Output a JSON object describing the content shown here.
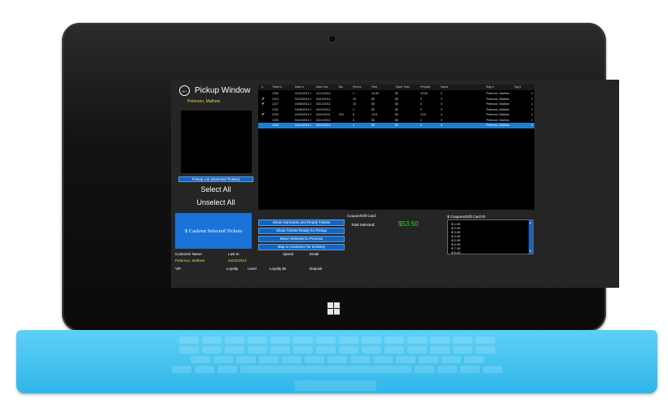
{
  "window": {
    "title": "Pickup Window",
    "back_glyph": "←",
    "customer_name": "Peterson, Mathew"
  },
  "left": {
    "pickup_list_label": "Pickup List (Selected Tickets)",
    "select_all": "Select All",
    "unselect_all": "Unselect All",
    "cashout_label": "$ Cashout Selected Tickets"
  },
  "customer_info": {
    "name_label": "Customer Name",
    "name_value": "Peterson, Mathew",
    "last_in_label": "Last In",
    "last_in_value": "04/10/2014",
    "vip_label": "VIP",
    "loyalty_label": "Loyalty",
    "level_label": "Level",
    "loyalty_dollars_label": "Loyalty $s",
    "spend_label": "Spend",
    "email_label": "Email",
    "deposit_label": "Deposit"
  },
  "tickets": {
    "columns": [
      "#",
      "Ticket #",
      "Date In",
      "Date Due",
      "Bin",
      "Pieces",
      "Paid",
      "Ticket Total",
      "Prepaid",
      "Name",
      "Bag #",
      "Tag #"
    ],
    "check_glyph": "✔",
    "rows": [
      {
        "checked": false,
        "selected": false,
        "cells": [
          "",
          "1200",
          "01/11/2014 1",
          "01/12/2014",
          "",
          "1",
          "19.50",
          "$0",
          "19.50",
          "0",
          "Peterson, Mathew",
          "",
          "1"
        ]
      },
      {
        "checked": true,
        "selected": false,
        "cells": [
          "",
          "1213",
          "03/15/2014 1",
          "03/19/2014",
          "",
          "15",
          "$0",
          "$0",
          "0",
          "0",
          "Peterson, Mathew",
          "",
          "1"
        ]
      },
      {
        "checked": true,
        "selected": false,
        "cells": [
          "",
          "1227",
          "04/08/2014 1",
          "04/12/2014",
          "",
          "15",
          "$0",
          "$0",
          "0",
          "0",
          "Peterson, Mathew",
          "",
          "1"
        ]
      },
      {
        "checked": false,
        "selected": false,
        "cells": [
          "",
          "1231",
          "04/08/2014 1",
          "04/10/2014",
          "",
          "1",
          "$0",
          "$0",
          "0",
          "0",
          "Peterson, Mathew",
          "",
          "1"
        ]
      },
      {
        "checked": true,
        "selected": false,
        "cells": [
          "",
          "1232",
          "04/09/2014 1",
          "04/11/2014",
          "204",
          "8",
          "13.8",
          "$0",
          "13.8",
          "0",
          "Peterson, Mathew",
          "",
          "1"
        ]
      },
      {
        "checked": false,
        "selected": false,
        "cells": [
          "",
          "1233",
          "04/10/2014 1",
          "04/12/2014",
          "",
          "5",
          "$0",
          "$0",
          "0",
          "0",
          "Peterson, Mathew",
          "",
          "1"
        ]
      },
      {
        "checked": false,
        "selected": true,
        "cells": [
          "",
          "1234",
          "04/10/2014 1",
          "04/13/2014",
          "",
          "1",
          "$0",
          "$0",
          "0",
          "0",
          "Peterson, Mathew",
          "",
          "1"
        ]
      }
    ]
  },
  "actions": {
    "show_garments": "Show Garments and Ready Tickets",
    "show_tickets_ready": "Show Tickets Ready for Pickup",
    "move_to_process": "Move Selected to Process",
    "map_to_customer": "Map to Customer for Delivery"
  },
  "payment": {
    "coupon_label": "Coupon/Gift Card",
    "total_selected_label": "Total Selected:",
    "total_selected_value": "$53.50",
    "coupon_list_label": "$ Coupons/Gift Card ID",
    "coupons": [
      "$ 1.00",
      "$ 2.00",
      "$ 3.00",
      "$ 4.00",
      "$ 5.00",
      "$ 6.00",
      "$ 7.00",
      "$ 8.00"
    ]
  },
  "colors": {
    "accent_blue": "#1565c0",
    "total_green": "#22dd22",
    "name_yellow": "#e8d25a",
    "keyboard_cyan": "#2fb6ea"
  }
}
